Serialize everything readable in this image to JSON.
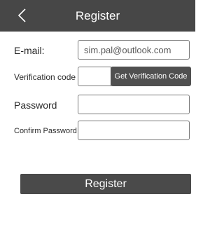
{
  "header": {
    "back_icon": "chevron-left-icon",
    "title": "Register"
  },
  "form": {
    "email": {
      "label": "E-mail:",
      "value": "sim.pal@outlook.com"
    },
    "verification": {
      "label": "Verification code",
      "value": "",
      "button_label": "Get Verification Code"
    },
    "password": {
      "label": "Password",
      "value": ""
    },
    "confirm_password": {
      "label": "Confirm Password",
      "value": ""
    }
  },
  "actions": {
    "register_label": "Register"
  },
  "colors": {
    "header_bg": "#474747",
    "button_bg": "#4a4a4a",
    "field_border": "#7a7a7a"
  }
}
